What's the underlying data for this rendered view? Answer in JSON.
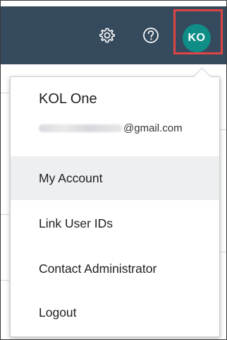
{
  "topbar": {
    "settings_icon": "gear-icon",
    "help_icon": "question-circle-icon",
    "avatar_initials": "KO",
    "avatar_color": "#0e8e87",
    "bar_color": "#364a5e",
    "highlight_color": "#e04545"
  },
  "user_menu": {
    "name": "KOL One",
    "email_domain": "@gmail.com",
    "items": [
      {
        "label": "My Account",
        "highlighted": true
      },
      {
        "label": "Link User IDs",
        "highlighted": false
      },
      {
        "label": "Contact Administrator",
        "highlighted": false
      },
      {
        "label": "Logout",
        "highlighted": false
      }
    ]
  }
}
